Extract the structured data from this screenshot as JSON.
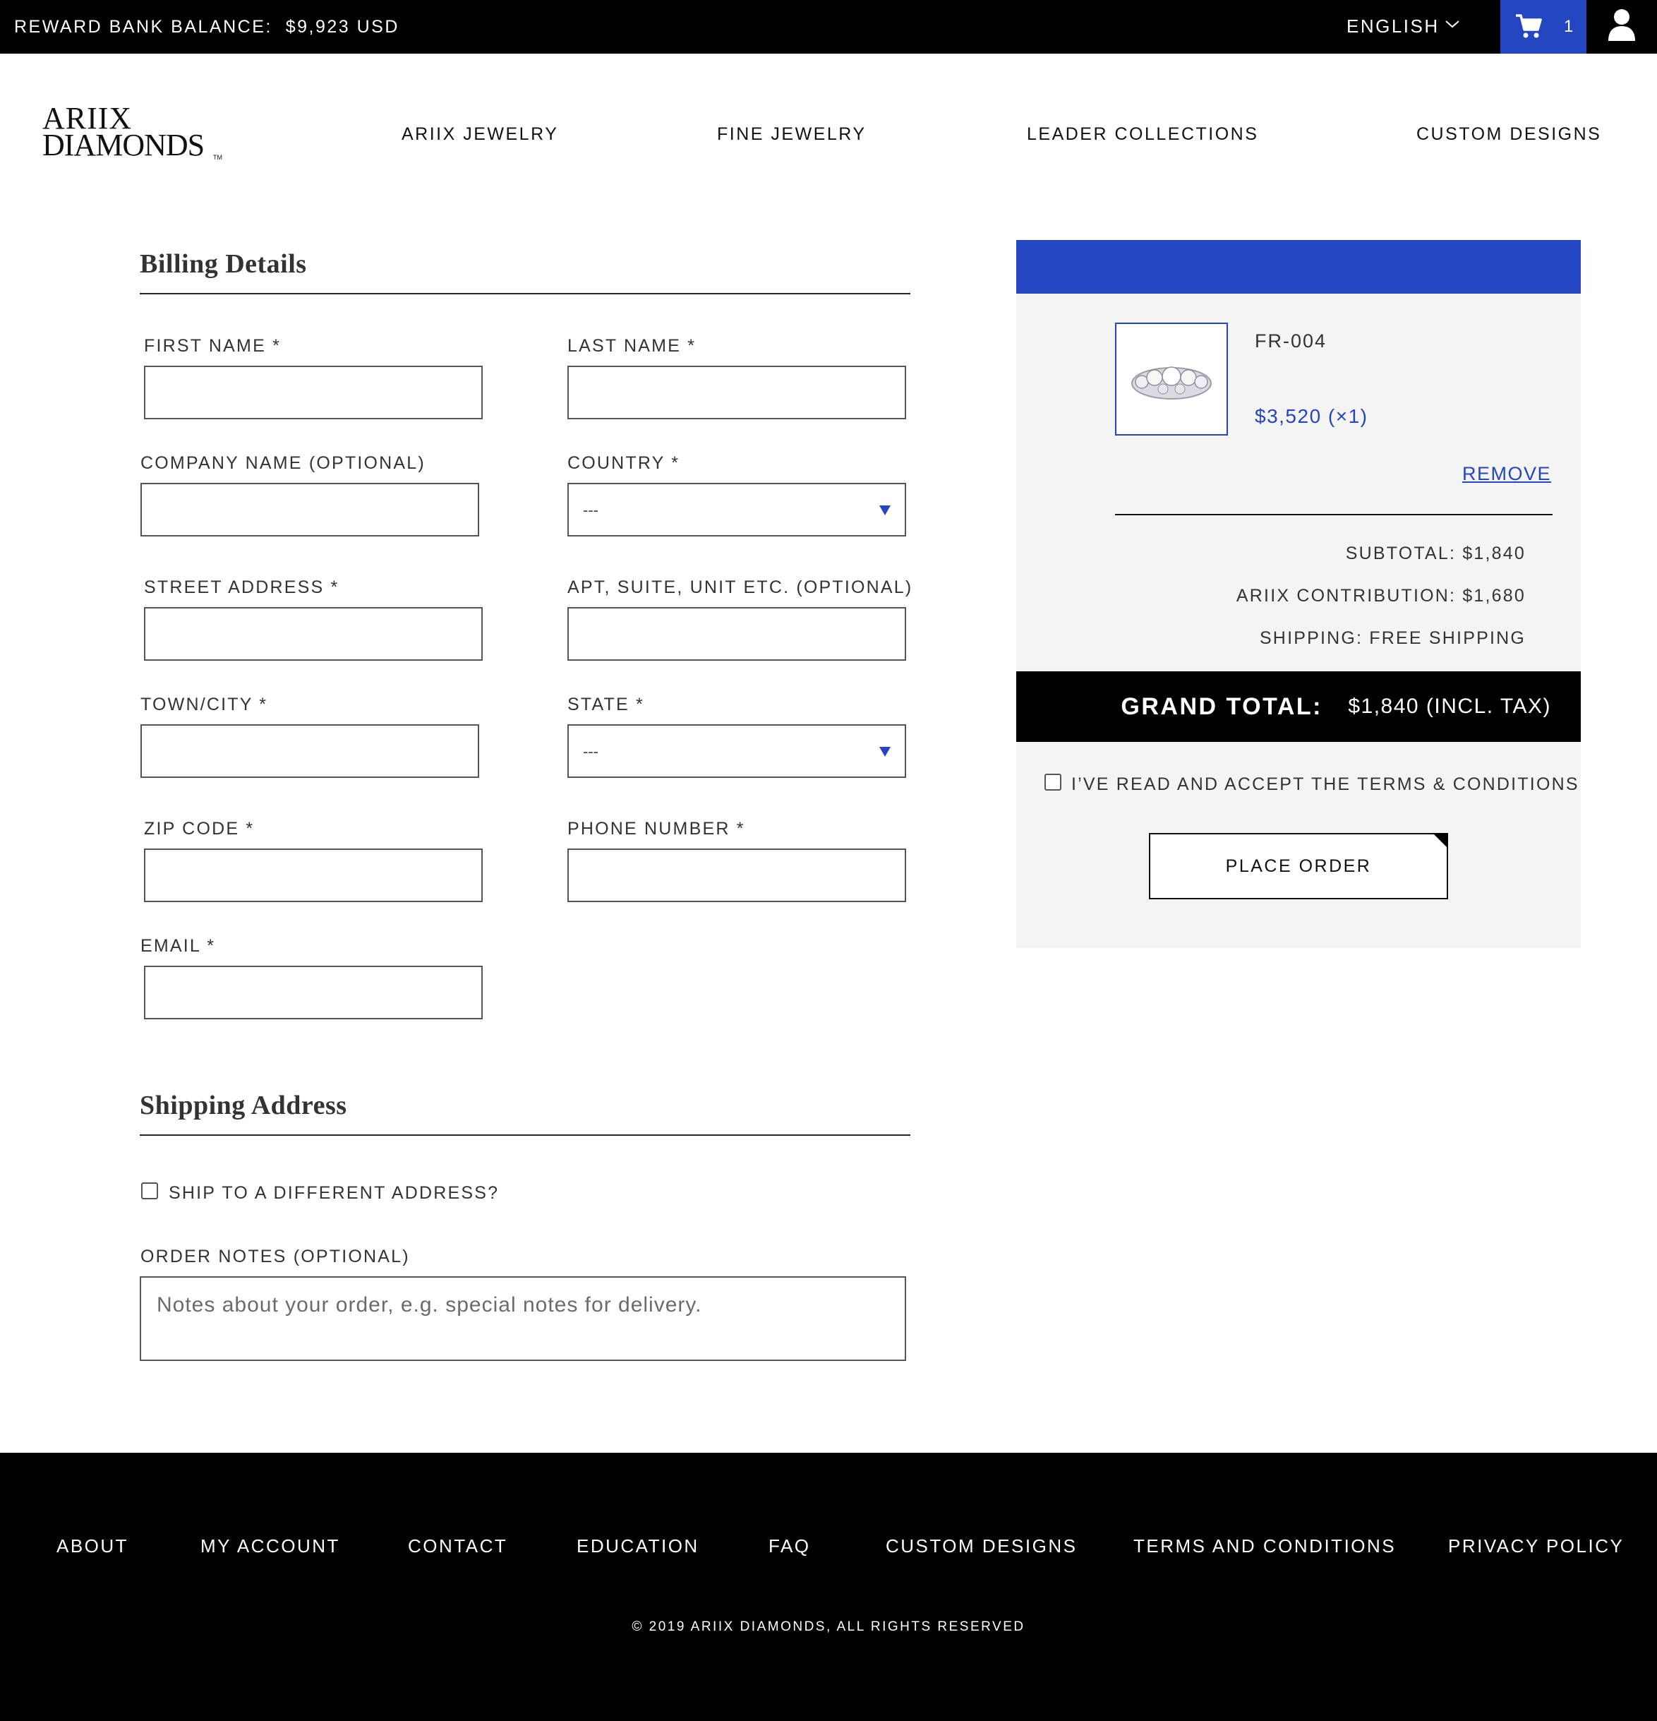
{
  "topbar": {
    "reward_label": "REWARD BANK BALANCE:",
    "reward_value": "$9,923 USD",
    "language": "ENGLISH",
    "cart_count": "1"
  },
  "brand": {
    "line1": "ARIIX",
    "line2": "DIAMONDS",
    "tm": "TM"
  },
  "nav": {
    "items": [
      "ARIIX JEWELRY",
      "FINE JEWELRY",
      "LEADER COLLECTIONS",
      "CUSTOM DESIGNS"
    ]
  },
  "billing": {
    "title": "Billing Details",
    "fields": {
      "first_name": "FIRST NAME *",
      "last_name": "LAST NAME *",
      "company": "COMPANY NAME (OPTIONAL)",
      "country": "COUNTRY *",
      "street": "STREET ADDRESS *",
      "apt": "APT, SUITE, UNIT ETC. (OPTIONAL)",
      "town": "TOWN/CITY *",
      "state": "STATE *",
      "zip": "ZIP CODE *",
      "phone": "PHONE NUMBER *",
      "email": "EMAIL *"
    },
    "country_value": "---",
    "state_value": "---"
  },
  "shipping": {
    "title": "Shipping Address",
    "ship_different": "SHIP TO A DIFFERENT ADDRESS?",
    "notes_label": "ORDER NOTES (OPTIONAL)",
    "notes_placeholder": "Notes about your order, e.g. special notes for delivery."
  },
  "summary": {
    "product_name": "FR-004",
    "product_price": "$3,520 (×1)",
    "remove": "REMOVE",
    "subtotal": "SUBTOTAL: $1,840",
    "contribution": "ARIIX CONTRIBUTION: $1,680",
    "shipping": "SHIPPING: FREE SHIPPING",
    "grand_total_label": "GRAND TOTAL:",
    "grand_total_value": "$1,840 (INCL. TAX)",
    "terms": "I’VE READ AND ACCEPT THE TERMS & CONDITIONS",
    "place_order": "PLACE ORDER"
  },
  "footer": {
    "links": [
      "ABOUT",
      "MY ACCOUNT",
      "CONTACT",
      "EDUCATION",
      "FAQ",
      "CUSTOM DESIGNS",
      "TERMS AND CONDITIONS",
      "PRIVACY POLICY"
    ],
    "copyright": "© 2019 ARIIX DIAMONDS,   ALL RIGHTS RESERVED"
  },
  "colors": {
    "accent": "#2546c1",
    "bar": "#000000",
    "panel": "#f4f4f4"
  }
}
